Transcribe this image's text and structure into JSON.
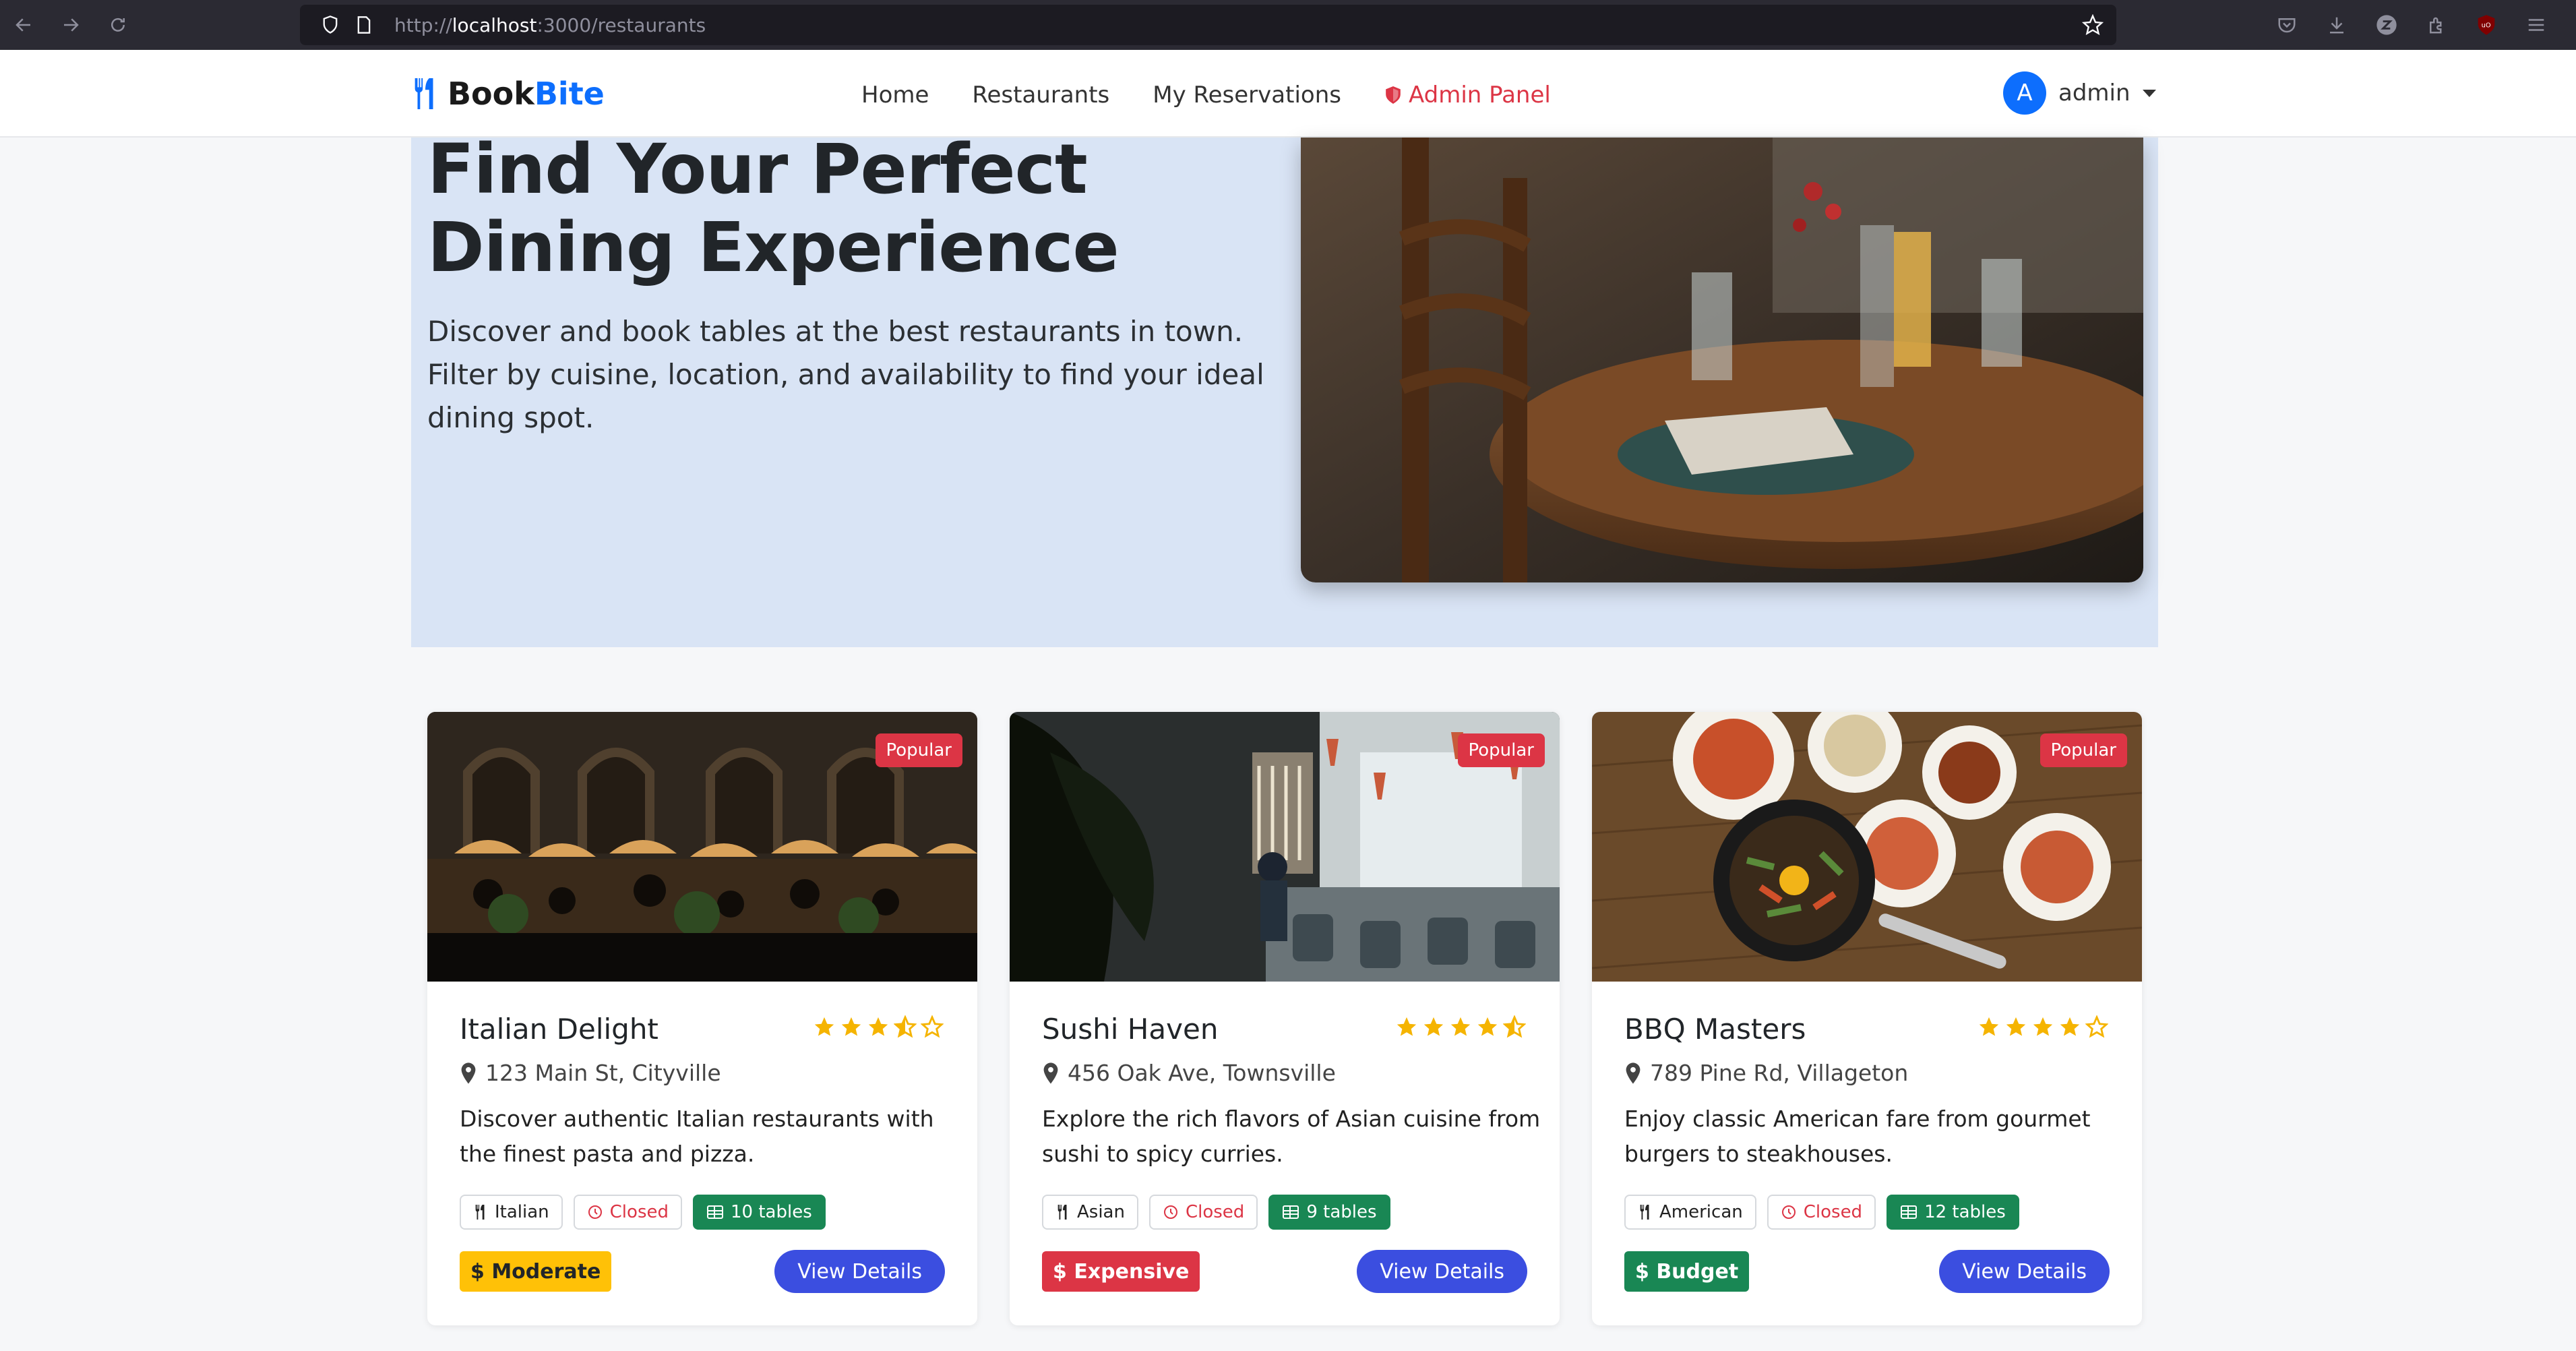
{
  "browser": {
    "url_prefix": "http://",
    "url_host": "localhost",
    "url_rest": ":3000/restaurants"
  },
  "nav": {
    "brand_part1": "Book",
    "brand_part2": "Bite",
    "links": [
      "Home",
      "Restaurants",
      "My Reservations"
    ],
    "admin_label": "Admin Panel",
    "user_initial": "A",
    "user_name": "admin"
  },
  "hero": {
    "title": "Find Your Perfect Dining Experience",
    "subtitle": "Discover and book tables at the best restaurants in town. Filter by cuisine, location, and availability to find your ideal dining spot."
  },
  "restaurants": [
    {
      "badge": "Popular",
      "name": "Italian Delight",
      "rating": 3.5,
      "address": "123 Main St, Cityville",
      "description": "Discover authentic Italian restaurants with the finest pasta and pizza.",
      "cuisine": "Italian",
      "status": "Closed",
      "tables": "10 tables",
      "price": "$ Moderate",
      "price_color": "#ffc107",
      "price_text_color": "#212529",
      "button": "View Details"
    },
    {
      "badge": "Popular",
      "name": "Sushi Haven",
      "rating": 4.5,
      "address": "456 Oak Ave, Townsville",
      "description": "Explore the rich flavors of Asian cuisine from sushi to spicy curries.",
      "cuisine": "Asian",
      "status": "Closed",
      "tables": "9 tables",
      "price": "$ Expensive",
      "price_color": "#dc3545",
      "price_text_color": "#ffffff",
      "button": "View Details"
    },
    {
      "badge": "Popular",
      "name": "BBQ Masters",
      "rating": 4,
      "address": "789 Pine Rd, Villageton",
      "description": "Enjoy classic American fare from gourmet burgers to steakhouses.",
      "cuisine": "American",
      "status": "Closed",
      "tables": "12 tables",
      "price": "$ Budget",
      "price_color": "#198754",
      "price_text_color": "#ffffff",
      "button": "View Details"
    }
  ],
  "colors": {
    "brand_blue": "#0d6efd",
    "admin_red": "#dc3545",
    "hero_bg": "#d9e4f5",
    "star": "#f5b400",
    "button": "#3b4ee0"
  }
}
